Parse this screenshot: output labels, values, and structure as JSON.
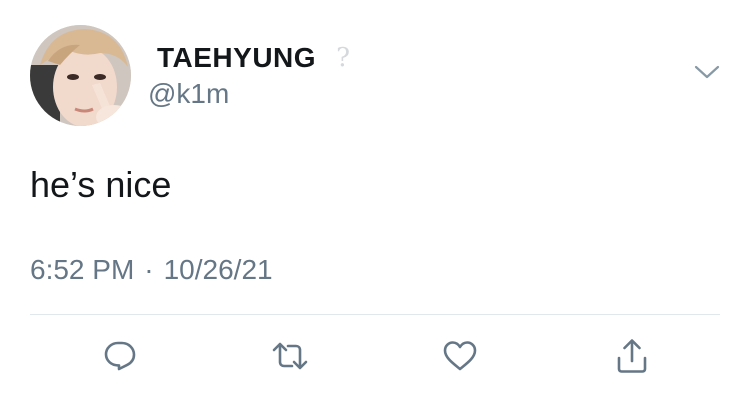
{
  "author": {
    "display_name": "TAEHYUNG",
    "unknown_glyph": "?",
    "handle": "@k1m"
  },
  "tweet": {
    "text": "he’s nice",
    "time": "6:52 PM",
    "separator": "·",
    "date": "10/26/21"
  },
  "icons": {
    "menu": "chevron-down-icon",
    "reply": "reply-icon",
    "retweet": "retweet-icon",
    "like": "heart-icon",
    "share": "share-icon"
  },
  "colors": {
    "text_primary": "#14171a",
    "text_secondary": "#657786",
    "icon": "#657786",
    "divider": "#e1e8ed"
  }
}
